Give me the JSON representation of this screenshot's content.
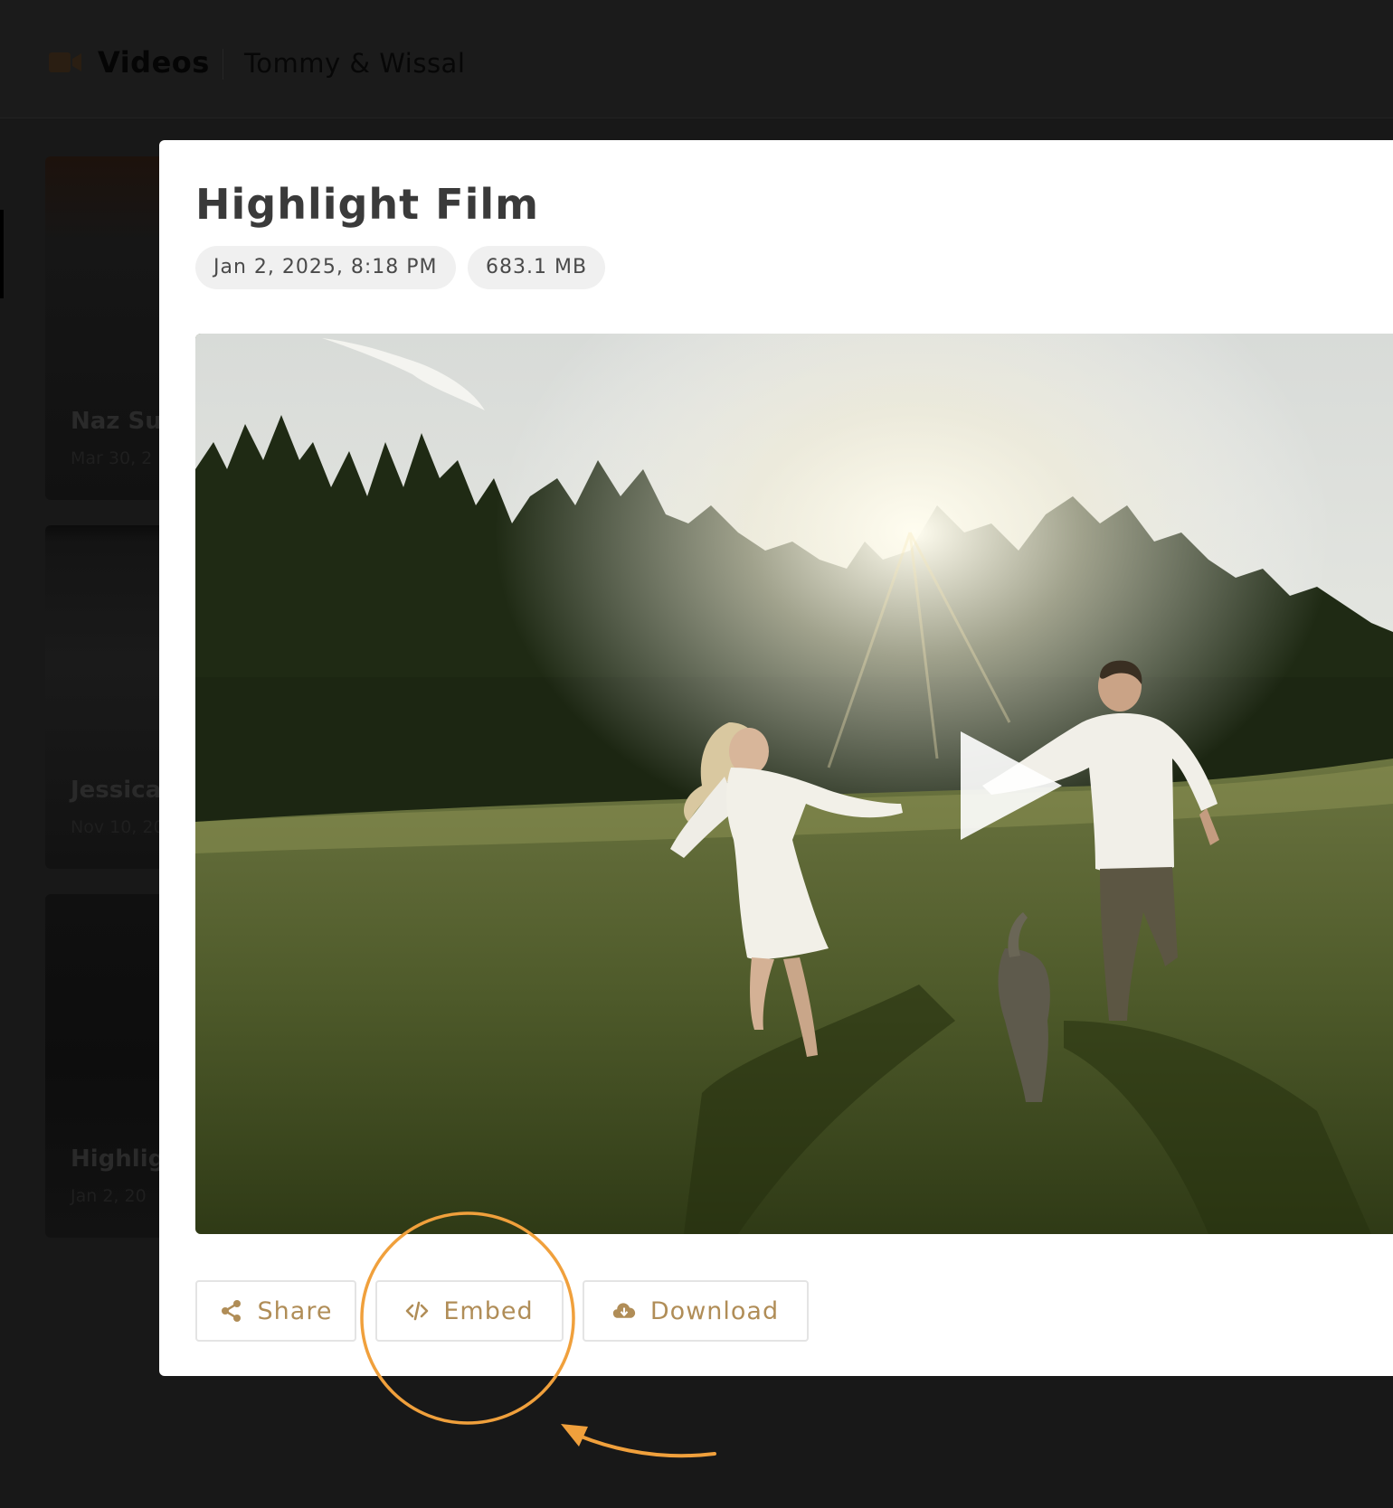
{
  "header": {
    "section_title": "Videos",
    "project_name": "Tommy & Wissal"
  },
  "background_cards": [
    {
      "title": "Naz Su",
      "date": "Mar 30, 2"
    },
    {
      "title": "Jessica",
      "date": "Nov 10, 20"
    },
    {
      "title": "Highligl",
      "date": "Jan 2, 20"
    }
  ],
  "modal": {
    "title": "Highlight Film",
    "date": "Jan 2, 2025, 8:18 PM",
    "size": "683.1 MB",
    "actions": {
      "share": "Share",
      "embed": "Embed",
      "download": "Download"
    }
  },
  "icons": {
    "header": "video-camera-icon",
    "share": "share-icon",
    "embed": "code-icon",
    "download": "cloud-download-icon",
    "play": "play-icon"
  },
  "colors": {
    "accent": "#b08d57",
    "annotation": "#f0a03c",
    "background": "#181818",
    "modal": "#ffffff"
  }
}
